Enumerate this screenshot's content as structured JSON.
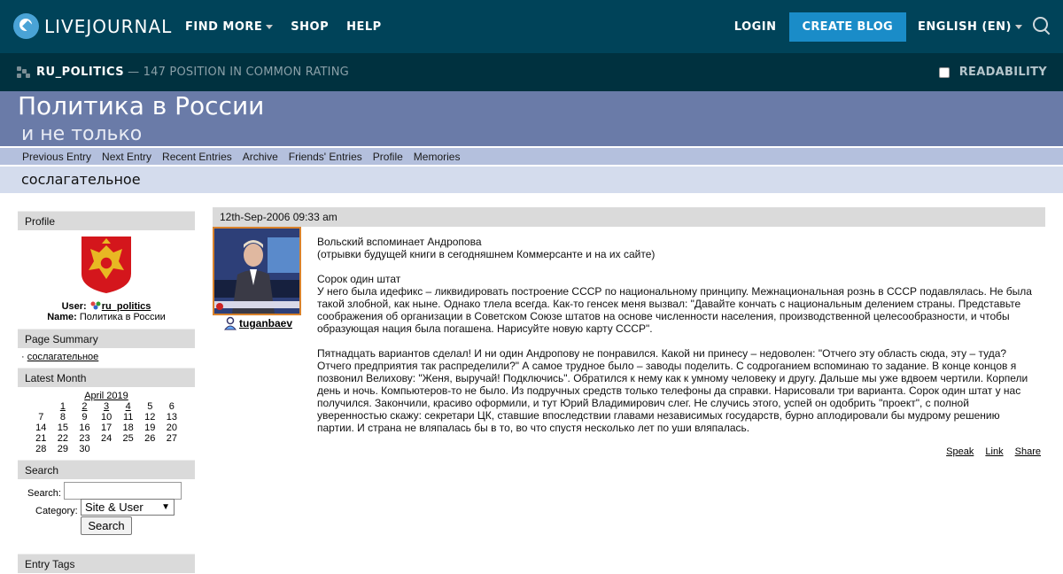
{
  "topnav": {
    "logo_text": "LIVEJOURNAL",
    "find_more": "FIND MORE",
    "shop": "SHOP",
    "help": "HELP",
    "login": "LOGIN",
    "create_blog": "CREATE BLOG",
    "language": "ENGLISH (EN)"
  },
  "journal_bar": {
    "name": "RU_POLITICS",
    "rank": "— 147 POSITION IN COMMON RATING",
    "readability": "READABILITY"
  },
  "header": {
    "title": "Политика в России",
    "subtitle": "и не только"
  },
  "journal_nav": [
    "Previous Entry",
    "Next Entry",
    "Recent Entries",
    "Archive",
    "Friends' Entries",
    "Profile",
    "Memories"
  ],
  "page_title": "сослагательное",
  "sidebar": {
    "profile_heading": "Profile",
    "user_label": "User:",
    "user_value": "ru_politics",
    "name_label": "Name:",
    "name_value": "Политика в России",
    "summary_heading": "Page Summary",
    "summary_item": "сослагательное",
    "latest_heading": "Latest Month",
    "month": "April 2019",
    "calendar": [
      [
        "",
        "1",
        "2",
        "3",
        "4",
        "5",
        "6"
      ],
      [
        "7",
        "8",
        "9",
        "10",
        "11",
        "12",
        "13"
      ],
      [
        "14",
        "15",
        "16",
        "17",
        "18",
        "19",
        "20"
      ],
      [
        "21",
        "22",
        "23",
        "24",
        "25",
        "26",
        "27"
      ],
      [
        "28",
        "29",
        "30",
        "",
        "",
        "",
        ""
      ]
    ],
    "linked_days": [
      "1",
      "2",
      "3",
      "4"
    ],
    "search_heading": "Search",
    "search_label": "Search:",
    "category_label": "Category:",
    "category_value": "Site & User",
    "search_button": "Search",
    "tags_heading": "Entry Tags"
  },
  "entry": {
    "date": "12th-Sep-2006 09:33 am",
    "poster": "tuganbaev",
    "paragraphs": [
      "Вольский вспоминает Андропова\n(отрывки будущей книги в сегодняшнем Коммерсанте и на их сайте)",
      "Сорок один штат\nУ него была идефикс – ликвидировать построение СССР по национальному принципу. Межнациональная рознь в СССР подавлялась. Не была такой злобной, как ныне. Однако тлела всегда. Как-то генсек меня вызвал: \"Давайте кончать с национальным делением страны. Представьте соображения об организации в Советском Союзе штатов на основе численности населения, производственной целесообразности, и чтобы образующая нация была погашена. Нарисуйте новую карту СССР\".",
      "Пятнадцать вариантов сделал! И ни один Андропову не понравился. Какой ни принесу – недоволен: \"Отчего эту область сюда, эту – туда? Отчего предприятия так распределили?\" А самое трудное было – заводы поделить. С содроганием вспоминаю то задание. В конце концов я позвонил Велихову: \"Женя, выручай! Подключись\". Обратился к нему как к умному человеку и другу. Дальше мы уже вдвоем чертили. Корпели день и ночь. Компьютеров-то не было. Из подручных средств только телефоны да справки. Нарисовали три варианта. Сорок один штат у нас получился. Закончили, красиво оформили, и тут Юрий Владимирович слег. Не случись этого, успей он одобрить \"проект\", с полной уверенностью скажу: секретари ЦК, ставшие впоследствии главами независимых государств, бурно аплодировали бы мудрому решению партии. И страна не вляпалась бы в то, во что спустя несколько лет по уши вляпалась."
    ],
    "actions": [
      "Speak",
      "Link",
      "Share"
    ]
  },
  "colors": {
    "topbar": "#004359",
    "journal_bar": "#00313f",
    "accent": "#1a8cc8",
    "header": "#6a7ba8",
    "navbar": "#b4c0dd"
  }
}
